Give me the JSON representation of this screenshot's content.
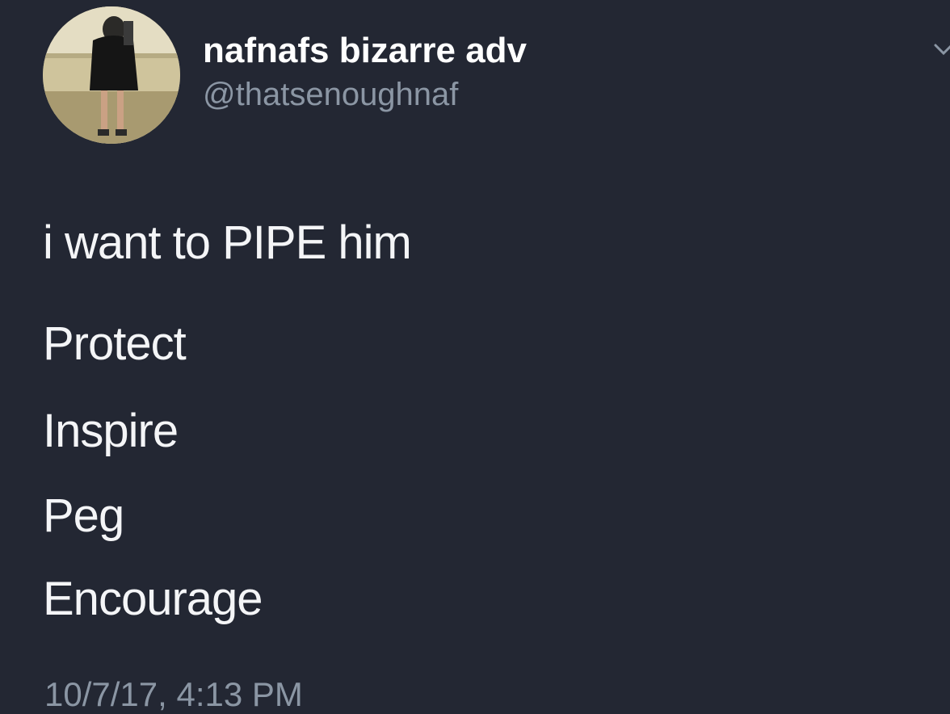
{
  "tweet": {
    "display_name": "nafnafs bizarre adv",
    "handle": "@thatsenoughnaf",
    "lines": [
      "i want to PIPE him",
      "Protect",
      "Inspire",
      "Peg",
      "Encourage"
    ],
    "timestamp": "10/7/17, 4:13 PM"
  },
  "icons": {
    "avatar": "profile-photo",
    "menu": "chevron-down-icon"
  },
  "colors": {
    "background": "#232733",
    "primary_text": "#ffffff",
    "secondary_text": "#8b96a4"
  }
}
